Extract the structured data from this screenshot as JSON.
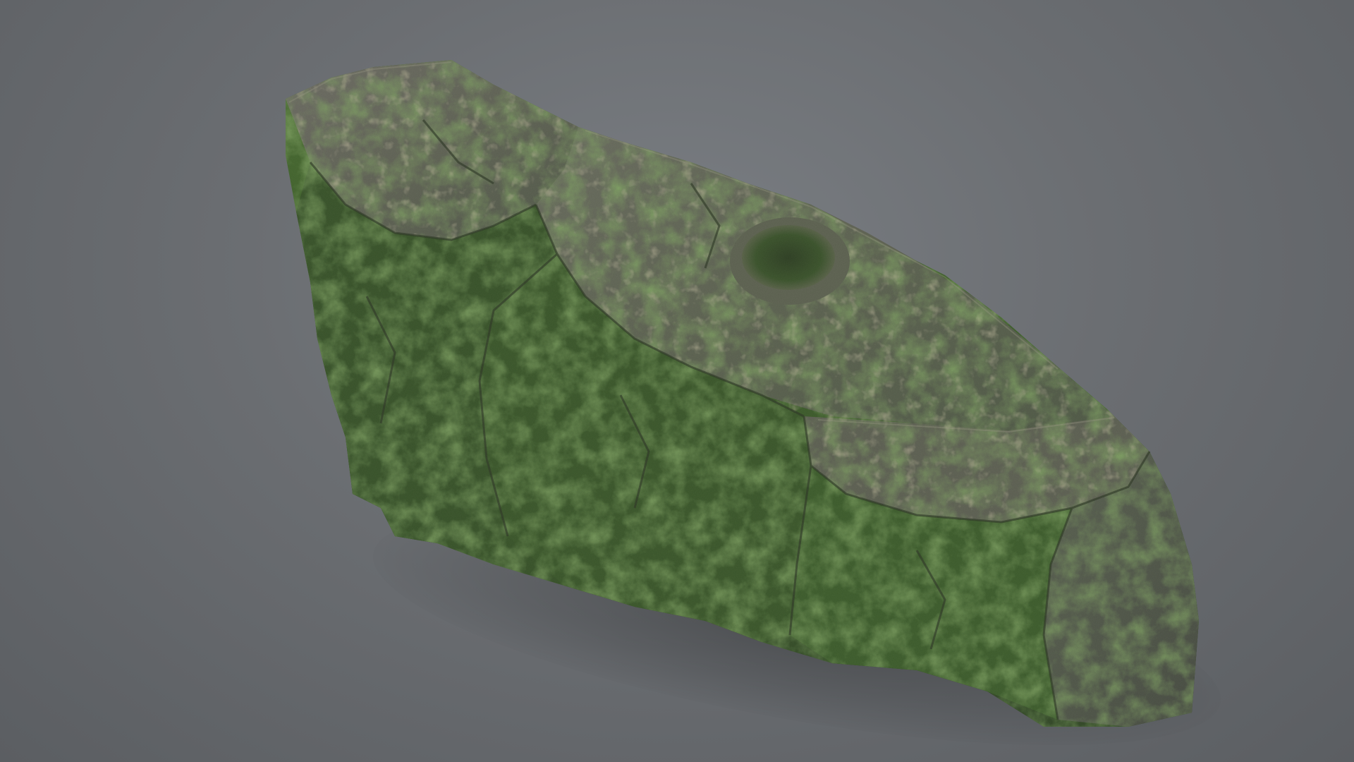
{
  "scene": {
    "subject": "moss-covered-rock-3d-model",
    "background_color": "#6d7074",
    "palette": {
      "rock_gray": "#6b6b62",
      "rock_dark": "#3e3f38",
      "moss_light": "#5e8c2a",
      "moss_mid": "#3f6e1f",
      "moss_dark": "#274a16",
      "lichen": "#9a8f58"
    }
  }
}
